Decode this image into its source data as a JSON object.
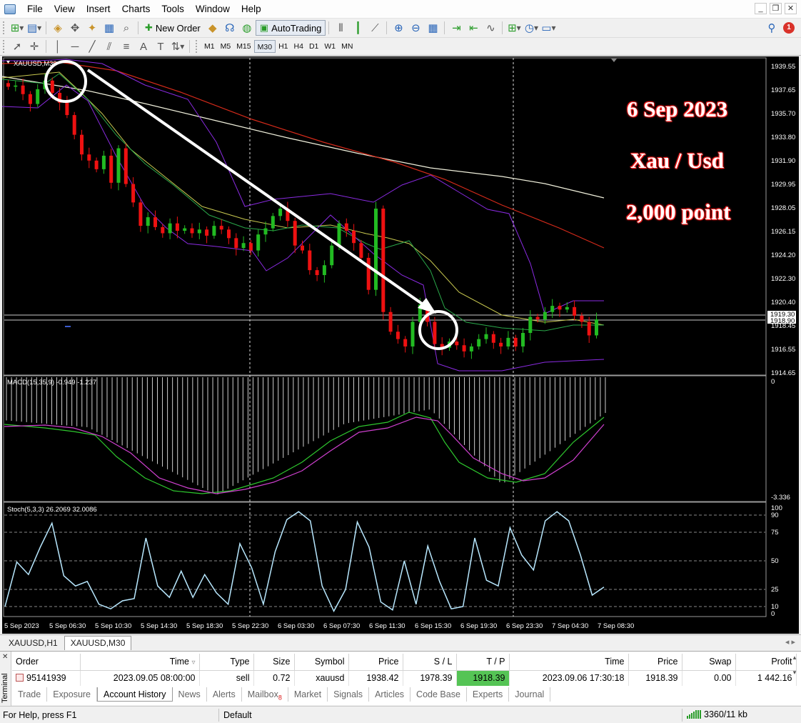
{
  "menu": [
    "File",
    "View",
    "Insert",
    "Charts",
    "Tools",
    "Window",
    "Help"
  ],
  "window_buttons": [
    "_",
    "❐",
    "✕"
  ],
  "toolbar": {
    "new_order_label": "New Order",
    "autotrading_label": "AutoTrading",
    "notification_count": "1",
    "timeframes": [
      "M1",
      "M5",
      "M15",
      "M30",
      "H1",
      "H4",
      "D1",
      "W1",
      "MN"
    ],
    "active_timeframe": "M30"
  },
  "chart": {
    "symbol_label": "XAUUSD,M30",
    "price_ticks": [
      "1939.55",
      "1937.65",
      "1935.70",
      "1933.80",
      "1931.90",
      "1929.95",
      "1928.05",
      "1926.15",
      "1924.20",
      "1922.30",
      "1920.40",
      "1918.45",
      "1916.55",
      "1914.65"
    ],
    "price_marker_1": "1919.30",
    "price_marker_2": "1918.90",
    "macd_label": "MACD(15,35,9) -0.949 -1.237",
    "macd_ticks": [
      "0",
      "-3.336"
    ],
    "stoch_label": "Stoch(5,3,3) 26.2069 32.0086",
    "stoch_ticks": [
      "100",
      "90",
      "75",
      "50",
      "25",
      "10",
      "0"
    ],
    "time_labels": [
      "5 Sep 2023",
      "5 Sep 06:30",
      "5 Sep 10:30",
      "5 Sep 14:30",
      "5 Sep 18:30",
      "5 Sep 22:30",
      "6 Sep 03:30",
      "6 Sep 07:30",
      "6 Sep 11:30",
      "6 Sep 15:30",
      "6 Sep 19:30",
      "6 Sep 23:30",
      "7 Sep 04:30",
      "7 Sep 08:30"
    ],
    "overlay": {
      "date": "6 Sep 2023",
      "pair": "Xau / Usd",
      "points": "2,000 point"
    },
    "colors": {
      "bull": "#22bb22",
      "bear": "#ee1111",
      "bollinger": "#8a2be2",
      "ma_slow": "#d42a1a",
      "ma_long": "#f0f0dc",
      "ma_fast": "#c9c950",
      "stoch": "#b8e8ff",
      "signal": "#d040d0"
    },
    "stoch_values": [
      10,
      49,
      38,
      62,
      83,
      37,
      28,
      32,
      12,
      8,
      15,
      17,
      70,
      28,
      18,
      41,
      18,
      38,
      22,
      12,
      65,
      44,
      12,
      58,
      86,
      93,
      85,
      28,
      6,
      25,
      84,
      62,
      14,
      7,
      50,
      12,
      63,
      32,
      8,
      10,
      70,
      33,
      28,
      79,
      55,
      42,
      85,
      93,
      85,
      55,
      20,
      27
    ]
  },
  "chart_tabs": [
    "XAUUSD,H1",
    "XAUUSD,M30"
  ],
  "active_chart_tab": "XAUUSD,M30",
  "terminal": {
    "side_label": "Terminal",
    "columns": [
      "Order",
      "Time",
      "Type",
      "Size",
      "Symbol",
      "Price",
      "S / L",
      "T / P",
      "Time",
      "Price",
      "Swap",
      "Profit"
    ],
    "rows": [
      [
        "95141939",
        "2023.09.05 08:00:00",
        "sell",
        "0.72",
        "xauusd",
        "1938.42",
        "1978.39",
        "1918.39",
        "2023.09.06 17:30:18",
        "1918.39",
        "0.00",
        "1 442.16"
      ]
    ],
    "tabs": [
      "Trade",
      "Exposure",
      "Account History",
      "News",
      "Alerts",
      "Mailbox",
      "Market",
      "Signals",
      "Articles",
      "Code Base",
      "Experts",
      "Journal"
    ],
    "active_tab": "Account History",
    "mailbox_badge": "8"
  },
  "status": {
    "help_text": "For Help, press F1",
    "profile": "Default",
    "connection": "3360/11 kb"
  }
}
